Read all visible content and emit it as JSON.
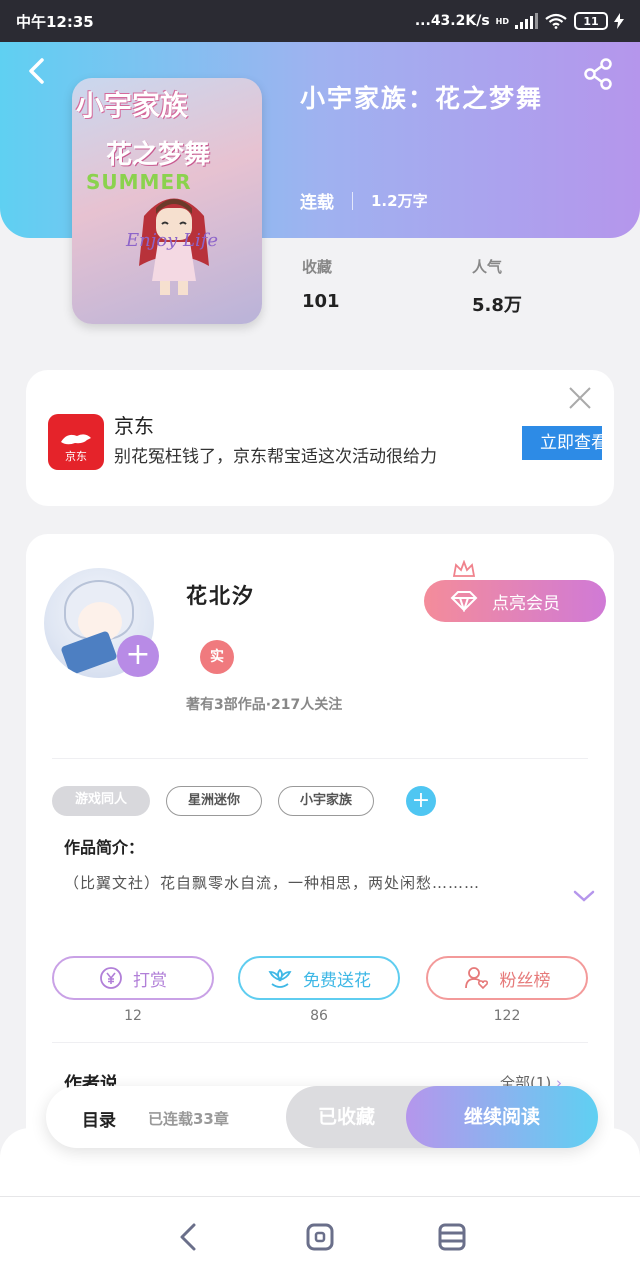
{
  "status_bar": {
    "time": "中午12:35",
    "speed": "...43.2K/s",
    "network": "HD",
    "battery": "11"
  },
  "book": {
    "title": "小宇家族：花之梦舞",
    "status": "连载",
    "word_count": "1.2万字",
    "cover": {
      "line1": "小宇家族",
      "line2": "花之梦舞",
      "line3": "SUMMER",
      "line4": "Enjoy Life"
    },
    "stats": [
      {
        "label": "收藏",
        "value": "101"
      },
      {
        "label": "人气",
        "value": "5.8万"
      }
    ]
  },
  "ad": {
    "brand": "京东",
    "logo_text": "京东",
    "description": "别花冤枉钱了，京东帮宝适这次活动很给力",
    "cta": "立即查看"
  },
  "author": {
    "name": "花北汐",
    "badge": "实",
    "info": "著有3部作品·217人关注",
    "vip_button": "点亮会员"
  },
  "tags": [
    "游戏同人",
    "星洲迷你",
    "小宇家族"
  ],
  "intro": {
    "heading": "作品简介：",
    "text": "（比翼文社）花自飘零水自流，一种相思，两处闲愁………"
  },
  "actions": [
    {
      "label": "打赏",
      "count": "12"
    },
    {
      "label": "免费送花",
      "count": "86"
    },
    {
      "label": "粉丝榜",
      "count": "122"
    }
  ],
  "author_say": {
    "heading": "作者说",
    "all_link": "全部(1)"
  },
  "bottom_bar": {
    "toc": "目录",
    "chapters": "已连载33章",
    "favorited": "已收藏",
    "continue": "继续阅读"
  },
  "colors": {
    "header_start": "#5fd0f2",
    "header_end": "#b596ec",
    "vip_start": "#f48c9a",
    "vip_end": "#d07ad6",
    "reward": "#b17fd8",
    "flower": "#3fb8e6",
    "fans": "#e67a7a",
    "ad_cta": "#2d8be6"
  }
}
